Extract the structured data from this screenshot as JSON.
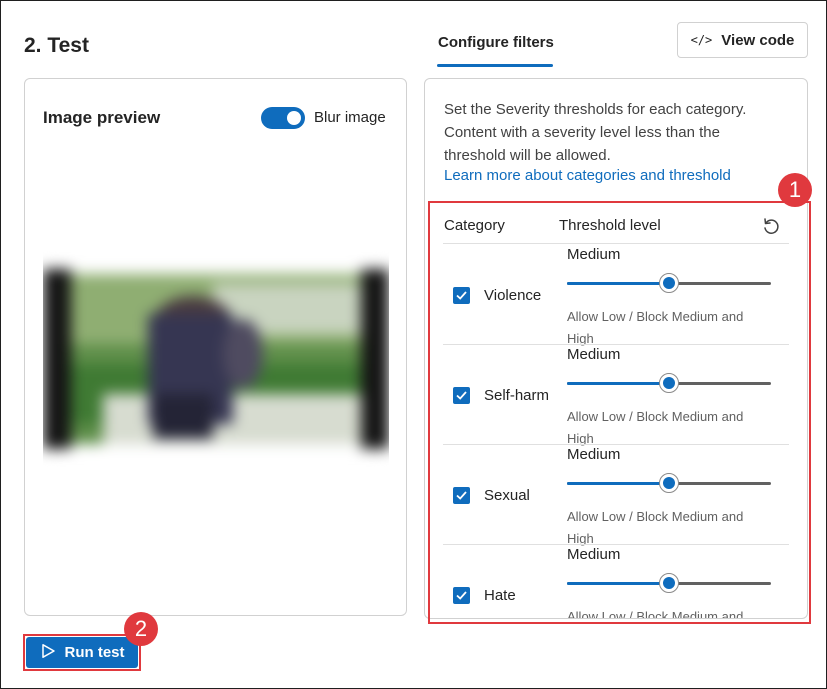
{
  "section_title": "2. Test",
  "preview": {
    "title": "Image preview",
    "blur_label": "Blur image",
    "blur_enabled": true
  },
  "tabs": [
    {
      "label": "Configure filters",
      "active": true
    }
  ],
  "view_code_label": "View code",
  "filters": {
    "description": "Set the Severity thresholds for each category. Content with a severity level less than the threshold will be allowed.",
    "learn_more": "Learn more about categories and threshold",
    "col_category": "Category",
    "col_threshold": "Threshold level",
    "rows": [
      {
        "category": "Violence",
        "level": "Medium",
        "note": "Allow Low / Block Medium and High",
        "checked": true,
        "slider_percent": 50
      },
      {
        "category": "Self-harm",
        "level": "Medium",
        "note": "Allow Low / Block Medium and High",
        "checked": true,
        "slider_percent": 50
      },
      {
        "category": "Sexual",
        "level": "Medium",
        "note": "Allow Low / Block Medium and High",
        "checked": true,
        "slider_percent": 50
      },
      {
        "category": "Hate",
        "level": "Medium",
        "note": "Allow Low / Block Medium and High",
        "checked": true,
        "slider_percent": 50
      }
    ]
  },
  "run_label": "Run test",
  "callouts": [
    "1",
    "2"
  ],
  "colors": {
    "accent": "#0f6cbd",
    "callout": "#e0393e"
  },
  "icons": {
    "view_code": "code-icon",
    "reset": "reset-icon",
    "run": "play-icon"
  }
}
